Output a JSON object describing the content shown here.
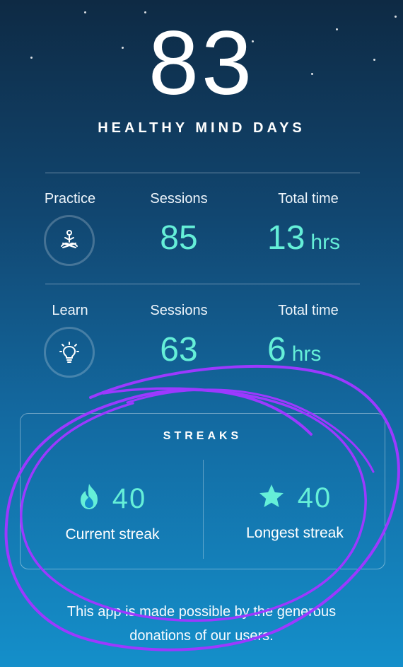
{
  "header": {
    "days_value": "83",
    "days_label": "HEALTHY MIND DAYS"
  },
  "practice": {
    "label": "Practice",
    "sessions_label": "Sessions",
    "sessions_value": "85",
    "time_label": "Total time",
    "time_value": "13",
    "time_unit": "hrs",
    "icon": "meditation-icon"
  },
  "learn": {
    "label": "Learn",
    "sessions_label": "Sessions",
    "sessions_value": "63",
    "time_label": "Total time",
    "time_value": "6",
    "time_unit": "hrs",
    "icon": "lightbulb-icon"
  },
  "streaks": {
    "title": "STREAKS",
    "current_value": "40",
    "current_label": "Current streak",
    "current_icon": "flame-icon",
    "longest_value": "40",
    "longest_label": "Longest streak",
    "longest_icon": "star-icon"
  },
  "footer": {
    "line1": "This app is made possible by the generous",
    "line2": "donations of our users."
  },
  "colors": {
    "accent": "#65efd8",
    "annotation": "#9c39ff",
    "background_top": "#0e2a44",
    "background_bottom": "#148fca"
  }
}
